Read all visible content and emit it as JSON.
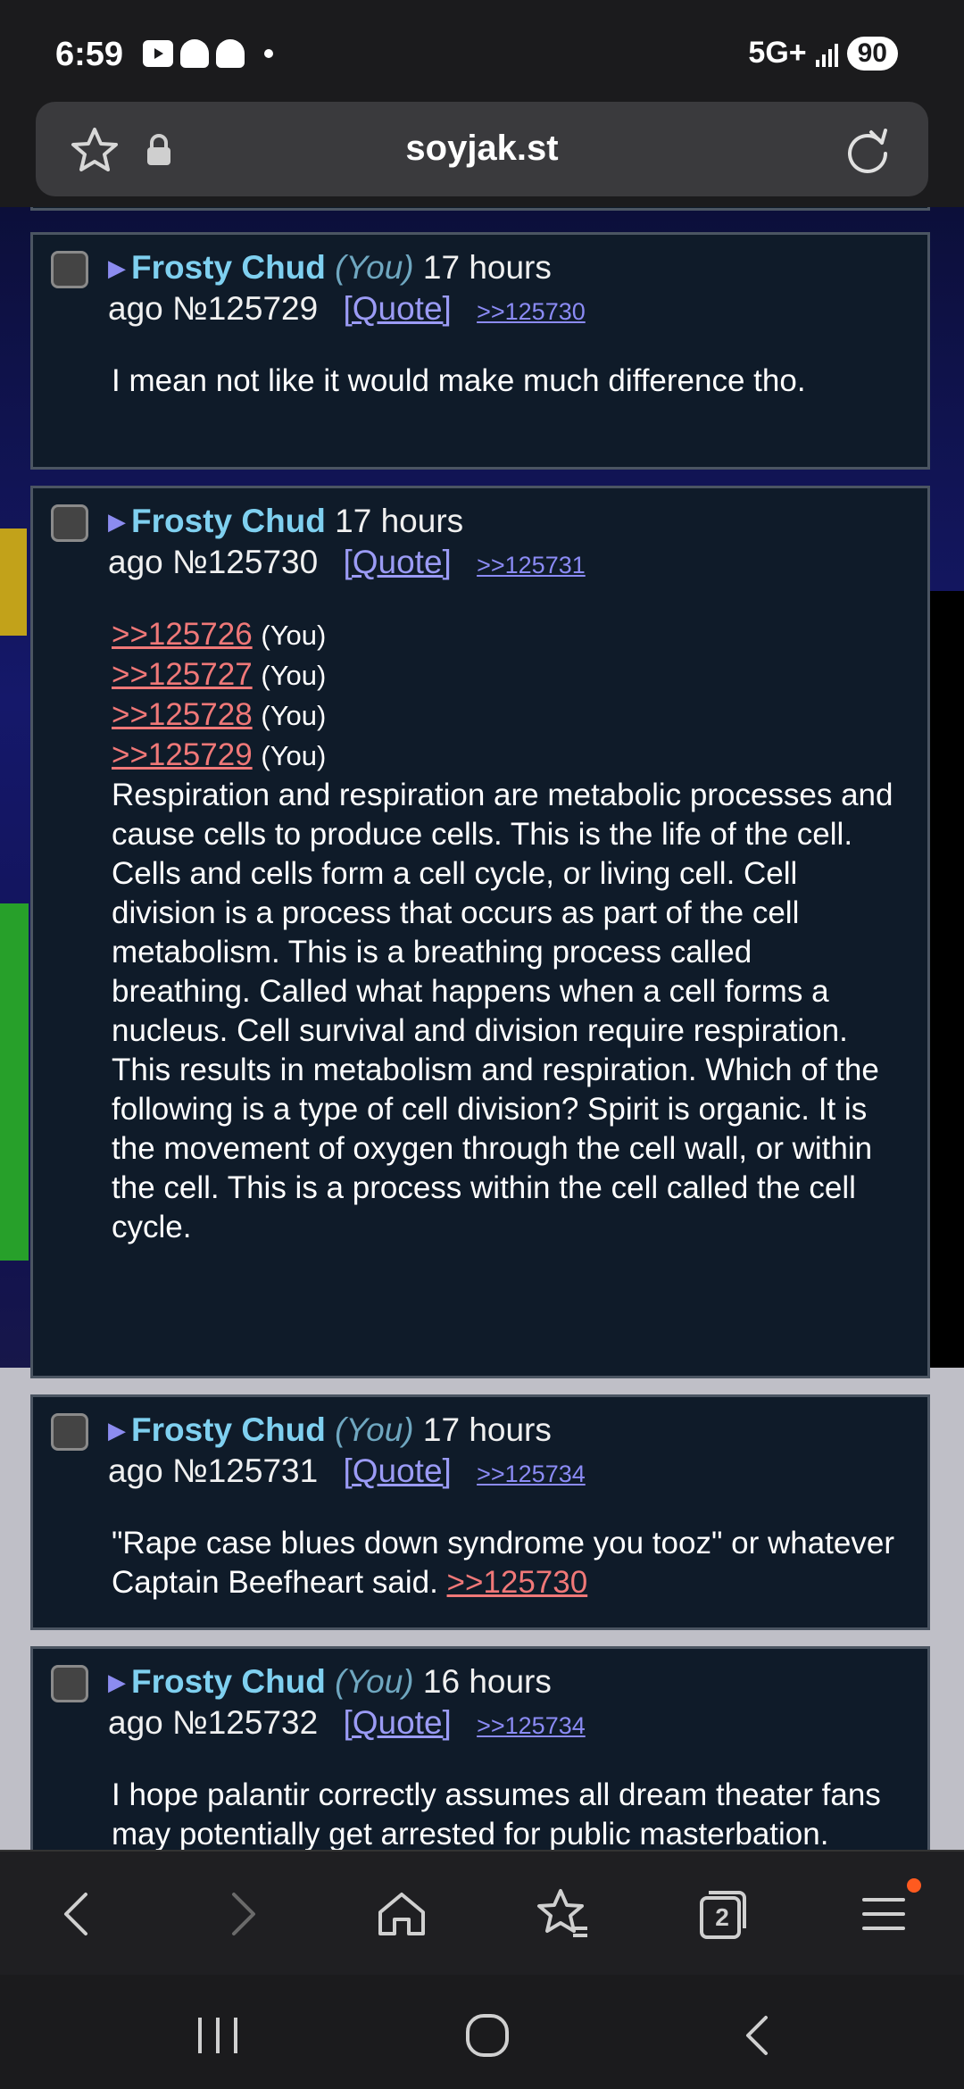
{
  "status": {
    "time": "6:59",
    "network": "5G+",
    "battery": "90"
  },
  "browser": {
    "url": "soyjak.st"
  },
  "posts": [
    {
      "name": "Frosty Chud",
      "you": "(You)",
      "time_line1": "17 hours",
      "time_line2": "ago",
      "number": "№125729",
      "quote": "[Quote]",
      "replies": ">>125730",
      "body": "I mean not like it would make much difference tho."
    },
    {
      "name": "Frosty Chud",
      "time_line1": "17 hours",
      "time_line2": "ago",
      "number": "№125730",
      "quote": "[Quote]",
      "replies": ">>125731",
      "refs": [
        {
          "link": ">>125726",
          "tag": "(You)"
        },
        {
          "link": ">>125727",
          "tag": "(You)"
        },
        {
          "link": ">>125728",
          "tag": "(You)"
        },
        {
          "link": ">>125729",
          "tag": "(You)"
        }
      ],
      "body": "Respiration and respiration are metabolic processes and cause cells to produce cells. This is the life of the cell. Cells and cells form a cell cycle, or living cell. Cell division is a process that occurs as part of the cell metabolism. This is a breathing process called breathing. Called what happens when a cell forms a nucleus. Cell survival and division require respiration. This results in metabolism and respiration. Which of the following is a type of cell division? Spirit is organic. It is the movement of oxygen through the cell wall, or within the cell. This is a process within the cell called the cell cycle."
    },
    {
      "name": "Frosty Chud",
      "you": "(You)",
      "time_line1": "17 hours",
      "time_line2": "ago",
      "number": "№125731",
      "quote": "[Quote]",
      "replies": ">>125734",
      "body": "\"Rape case blues down syndrome you tooz\" or whatever Captain Beefheart said.",
      "inline_link": ">>125730"
    },
    {
      "name": "Frosty Chud",
      "you": "(You)",
      "time_line1": "16 hours",
      "time_line2": "ago",
      "number": "№125732",
      "quote": "[Quote]",
      "replies": ">>125734",
      "body": "I hope palantir correctly assumes all dream theater fans may potentially get arrested for public masterbation. Peter Theil if you're"
    }
  ],
  "nav": {
    "tabs_count": "2"
  },
  "colors": {
    "name": "#7fd0f0",
    "post_bg": "#0f1b29",
    "quote_link": "#9b9bf5",
    "red_link": "#f07878"
  }
}
